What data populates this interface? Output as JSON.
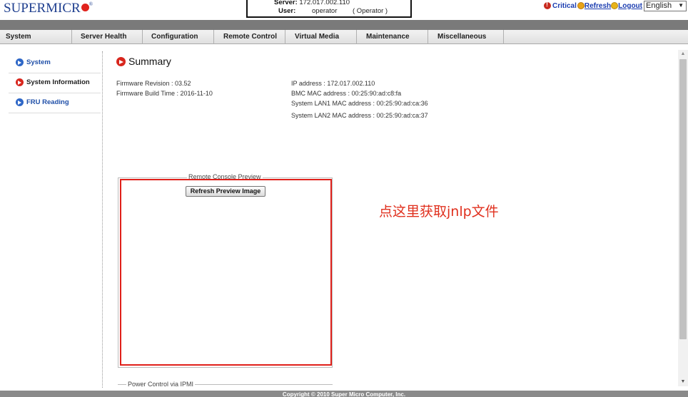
{
  "header": {
    "logo_text": "SUPERMICR",
    "logo_mark": "®",
    "server_label": "Server:",
    "server_value": "172.017.002.110",
    "user_label": "User:",
    "user_value": "operator",
    "user_role": "( Operator )",
    "critical_label": "Critical",
    "refresh_label": "Refresh",
    "logout_label": "Logout",
    "language": "English"
  },
  "nav": {
    "items": [
      "System",
      "Server Health",
      "Configuration",
      "Remote Control",
      "Virtual Media",
      "Maintenance",
      "Miscellaneous"
    ]
  },
  "sidebar": {
    "items": [
      {
        "label": "System",
        "active": false
      },
      {
        "label": "System Information",
        "active": true
      },
      {
        "label": "FRU Reading",
        "active": false
      }
    ]
  },
  "summary": {
    "title": "Summary",
    "firmware_revision": "Firmware Revision : 03.52",
    "firmware_build_time": "Firmware Build Time : 2016-11-10",
    "ip_address": "IP address : 172.017.002.110",
    "bmc_mac": "BMC MAC address : 00:25:90:ad:c8:fa",
    "lan1_mac": "System LAN1 MAC address : 00:25:90:ad:ca:36",
    "lan2_mac": "System LAN2 MAC address : 00:25:90:ad:ca:37"
  },
  "preview": {
    "legend": "Remote Console Preview",
    "refresh_button": "Refresh Preview Image"
  },
  "annotation": "点这里获取jnlp文件",
  "power_legend": "Power Control via IPMI",
  "footer": "Copyright © 2010 Super Micro Computer, Inc.",
  "colors": {
    "brand_blue": "#1f3f8f",
    "brand_red": "#e0231d",
    "highlight_red": "#e0201a",
    "link_blue": "#1a3cb0"
  }
}
